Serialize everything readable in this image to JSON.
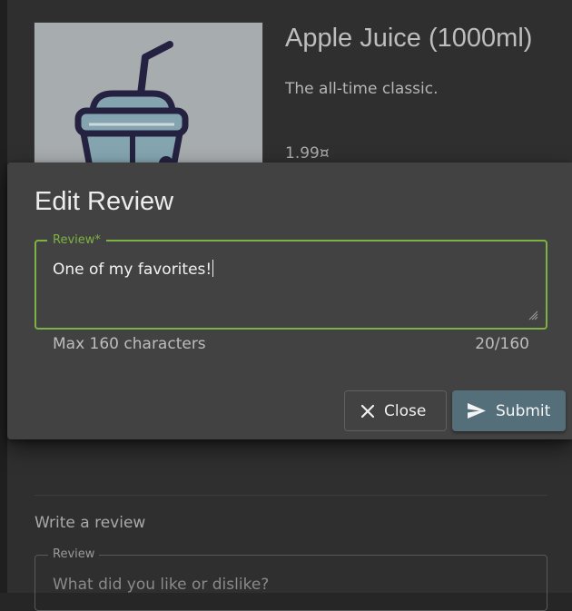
{
  "product": {
    "title": "Apple Juice (1000ml)",
    "description": "The all-time classic.",
    "price": "1.99¤",
    "image_icon": "drink-cup-with-straw"
  },
  "dialog": {
    "title": "Edit Review",
    "field_label": "Review*",
    "field_value": "One of my favorites!",
    "hint": "Max 160 characters",
    "counter": "20/160",
    "close_label": "Close",
    "submit_label": "Submit",
    "accent_color": "#7cb342",
    "submit_color": "#546e7a"
  },
  "write_review": {
    "heading": "Write a review",
    "field_label": "Review",
    "placeholder": "What did you like or dislike?"
  }
}
